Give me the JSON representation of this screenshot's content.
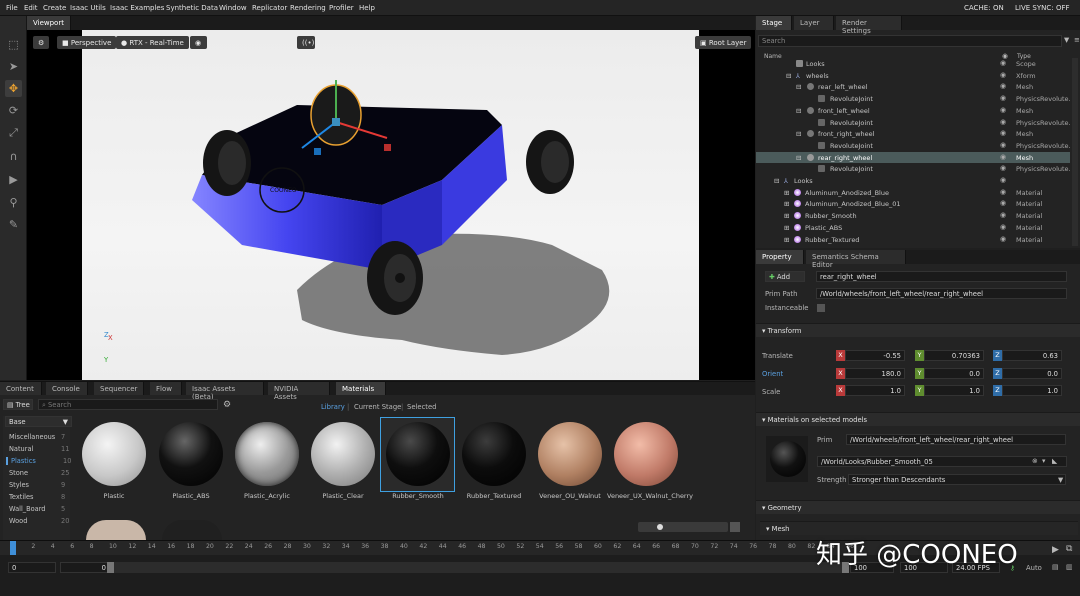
{
  "menu": [
    "File",
    "Edit",
    "Create",
    "Isaac Utils",
    "Isaac Examples",
    "Synthetic Data",
    "Window",
    "Replicator",
    "Rendering",
    "Profiler",
    "Help"
  ],
  "status": {
    "cache_label": "CACHE:",
    "cache_value": "ON",
    "live_label": "LIVE SYNC:",
    "live_value": "OFF"
  },
  "viewport": {
    "tab": "Viewport",
    "camera": "Perspective",
    "renderer": "RTX - Real-Time",
    "root_layer": "Root Layer",
    "axis_x": "X",
    "axis_y": "Y",
    "axis_z": "Z",
    "logo_text": "COONEO"
  },
  "stage": {
    "tabs": [
      "Stage",
      "Layer",
      "Render Settings"
    ],
    "search_placeholder": "Search",
    "col_name": "Name",
    "col_type": "Type",
    "rows": [
      {
        "name": "Looks",
        "type": "Scope"
      },
      {
        "name": "wheels",
        "type": "Xform"
      },
      {
        "name": "rear_left_wheel",
        "type": "Mesh"
      },
      {
        "name": "RevoluteJoint",
        "type": "PhysicsRevolute..."
      },
      {
        "name": "front_left_wheel",
        "type": "Mesh"
      },
      {
        "name": "RevoluteJoint",
        "type": "PhysicsRevolute..."
      },
      {
        "name": "front_right_wheel",
        "type": "Mesh"
      },
      {
        "name": "RevoluteJoint",
        "type": "PhysicsRevolute..."
      },
      {
        "name": "rear_right_wheel",
        "type": "Mesh"
      },
      {
        "name": "RevoluteJoint",
        "type": "PhysicsRevolute..."
      },
      {
        "name": "Looks",
        "type": ""
      },
      {
        "name": "Aluminum_Anodized_Blue",
        "type": "Material"
      },
      {
        "name": "Aluminum_Anodized_Blue_01",
        "type": "Material"
      },
      {
        "name": "Rubber_Smooth",
        "type": "Material"
      },
      {
        "name": "Plastic_ABS",
        "type": "Material"
      },
      {
        "name": "Rubber_Textured",
        "type": "Material"
      }
    ]
  },
  "property": {
    "tabs": [
      "Property",
      "Semantics Schema Editor"
    ],
    "add_label": "Add",
    "prim_name": "rear_right_wheel",
    "prim_path_label": "Prim Path",
    "prim_path": "/World/wheels/front_left_wheel/rear_right_wheel",
    "instanceable_label": "Instanceable",
    "transform_label": "Transform",
    "translate_label": "Translate",
    "translate": [
      "-0.55",
      "0.70363",
      "0.63"
    ],
    "orient_label": "Orient",
    "orient": [
      "180.0",
      "0.0",
      "0.0"
    ],
    "scale_label": "Scale",
    "scale": [
      "1.0",
      "1.0",
      "1.0"
    ],
    "ax_x": "X",
    "ax_y": "Y",
    "ax_z": "Z",
    "materials_label": "Materials on selected models",
    "prim_label": "Prim",
    "mat_prim": "/World/wheels/front_left_wheel/rear_right_wheel",
    "mat_path": "/World/Looks/Rubber_Smooth_05",
    "strength_label": "Strength",
    "strength": "Stronger than Descendants",
    "geometry_label": "Geometry",
    "mesh_label": "Mesh"
  },
  "content": {
    "tabs": [
      "Content",
      "Console",
      "Sequencer",
      "Flow",
      "Isaac Assets (Beta)",
      "NVIDIA Assets",
      "Materials"
    ],
    "tree_label": "Tree",
    "search_placeholder": "Search",
    "filters": [
      "Library",
      "Current Stage",
      "Selected"
    ],
    "base_label": "Base",
    "categories": [
      {
        "name": "Miscellaneous",
        "count": "7"
      },
      {
        "name": "Natural",
        "count": "11"
      },
      {
        "name": "Plastics",
        "count": "10"
      },
      {
        "name": "Stone",
        "count": "25"
      },
      {
        "name": "Styles",
        "count": "9"
      },
      {
        "name": "Textiles",
        "count": "8"
      },
      {
        "name": "Wall_Board",
        "count": "5"
      },
      {
        "name": "Wood",
        "count": "20"
      }
    ],
    "materials": [
      "Plastic",
      "Plastic_ABS",
      "Plastic_Acrylic",
      "Plastic_Clear",
      "Rubber_Smooth",
      "Rubber_Textured",
      "Veneer_OU_Walnut",
      "Veneer_UX_Walnut_Cherry"
    ]
  },
  "timeline": {
    "ticks": [
      "0",
      "2",
      "4",
      "6",
      "8",
      "10",
      "12",
      "14",
      "16",
      "18",
      "20",
      "22",
      "24",
      "26",
      "28",
      "30",
      "32",
      "34",
      "36",
      "38",
      "40",
      "42",
      "44",
      "46",
      "48",
      "50",
      "52",
      "54",
      "56",
      "58",
      "60",
      "62",
      "64",
      "66",
      "68",
      "70",
      "72",
      "74",
      "76",
      "78",
      "80",
      "82",
      "84",
      "86"
    ],
    "start": "0",
    "current": "0",
    "end": "100",
    "end2": "100",
    "fps": "24.00 FPS",
    "auto": "Auto"
  },
  "watermark": "知乎 @COONEO",
  "colors": {
    "accent": "#e8a030",
    "cache_on": "#6fd33b",
    "live_off": "#e04a3a",
    "robot_blue": "#3a3ae0"
  }
}
